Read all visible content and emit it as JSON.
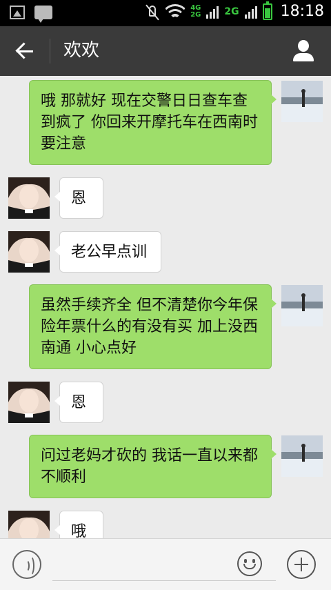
{
  "status_bar": {
    "time": "18:18",
    "network_4g": "4G",
    "network_2g_small": "2G",
    "network_2g": "2G"
  },
  "header": {
    "title": "欢欢"
  },
  "messages": [
    {
      "side": "out",
      "text": "哦 那就好 现在交警日日查车查到疯了 你回来开摩托车在西南时要注意"
    },
    {
      "side": "in",
      "text": "恩"
    },
    {
      "side": "in",
      "text": "老公早点训"
    },
    {
      "side": "out",
      "text": "虽然手续齐全 但不清楚你今年保险年票什么的有没有买 加上没西南通 小心点好"
    },
    {
      "side": "in",
      "text": "恩"
    },
    {
      "side": "out",
      "text": "问过老妈才砍的 我话一直以来都不顺利"
    },
    {
      "side": "in",
      "text": "哦"
    }
  ],
  "colors": {
    "outgoing_bubble": "#9ede6a",
    "incoming_bubble": "#ffffff",
    "title_bar": "#3a3a3a",
    "chat_background": "#ebebeb"
  },
  "icons": {
    "back": "back-arrow-icon",
    "profile": "person-icon",
    "voice": "voice-icon",
    "emoji": "smiley-icon",
    "more": "plus-icon"
  }
}
